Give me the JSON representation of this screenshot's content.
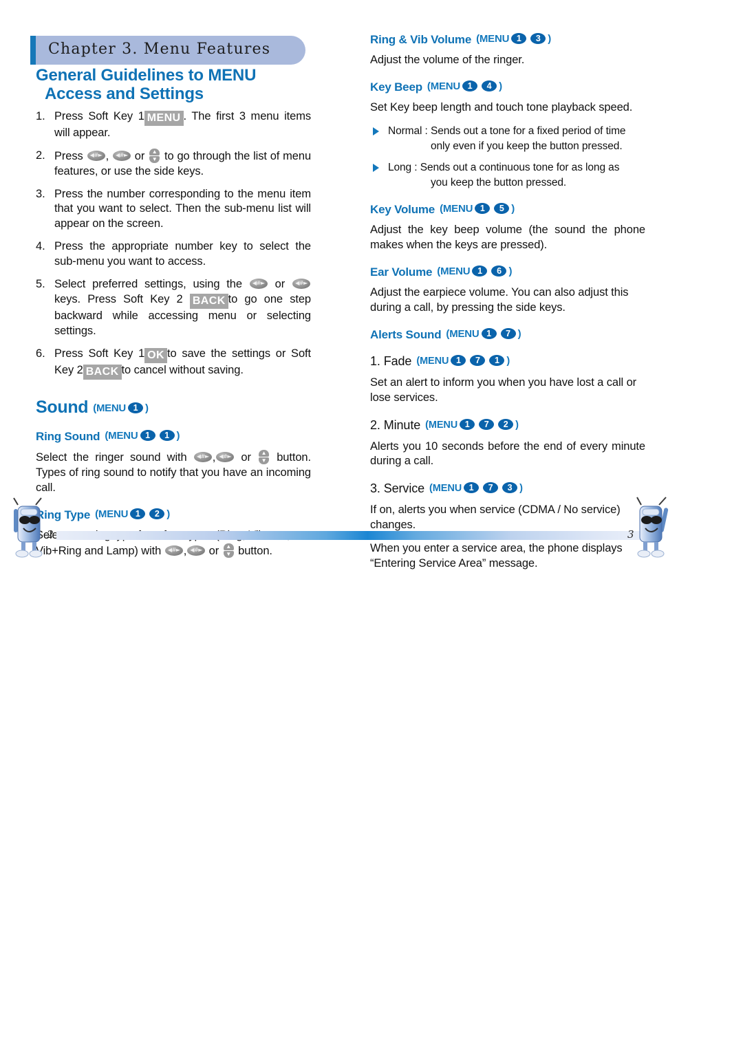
{
  "chapter": {
    "banner_text": "Chapter 3. Menu Features"
  },
  "left_column": {
    "heading_line1": "General Guidelines to MENU",
    "heading_line2": "Access and Settings",
    "steps": [
      {
        "num": "1.",
        "text_before": "Press Soft Key 1",
        "softkey": "MENU",
        "text_after": ". The first 3 menu items will appear."
      },
      {
        "num": "2.",
        "text_before": "Press",
        "text_mid": ", ",
        "text_or": "or",
        "text_after": "to go through the list of menu features, or use the side keys."
      },
      {
        "num": "3.",
        "text": "Press the number corresponding to the menu item that you want to select. Then the sub-menu list will appear on the screen."
      },
      {
        "num": "4.",
        "text": "Press the appropriate number key to select the sub-menu you want to access."
      },
      {
        "num": "5.",
        "text_a": "Select preferred settings, using the",
        "text_or": "or",
        "text_b": "keys. Press Soft Key 2",
        "softkey": "BACK",
        "text_c": "to go one step backward while accessing menu or selecting settings."
      },
      {
        "num": "6.",
        "text_a": "Press Soft Key 1",
        "softkey_ok": "OK",
        "text_b": "to save the settings or Soft Key 2",
        "softkey_back": "BACK",
        "text_c": "to cancel without saving."
      }
    ],
    "sound_section": {
      "title": "Sound",
      "menu_label": "MENU",
      "menu_codes": [
        "1"
      ]
    },
    "entries": [
      {
        "title": "Ring Sound",
        "menu_label": "MENU",
        "menu_codes": [
          "1",
          "1"
        ],
        "body_a": "Select the ringer sound with",
        "body_or": "or",
        "body_b": "button. Types of ring sound to notify that you have an incoming call."
      },
      {
        "title": "Ring Type",
        "menu_label": "MENU",
        "menu_codes": [
          "1",
          "2"
        ],
        "body_a": "Select one ring type from four types (Ring, Vibrator, Vib+Ring and Lamp) with",
        "body_or": "or",
        "body_b": "button."
      }
    ]
  },
  "right_column": {
    "entries": [
      {
        "title": "Ring & Vib Volume",
        "menu_label": "MENU",
        "menu_codes": [
          "1",
          "3"
        ],
        "body": "Adjust the volume of the ringer."
      },
      {
        "title": "Key Beep",
        "menu_label": "MENU",
        "menu_codes": [
          "1",
          "4"
        ],
        "body": "Set Key beep length and touch tone playback speed."
      },
      {
        "title": "Key Volume",
        "menu_label": "MENU",
        "menu_codes": [
          "1",
          "5"
        ],
        "body": "Adjust the key beep volume (the sound the phone makes when the keys are pressed)."
      },
      {
        "title": "Ear Volume",
        "menu_label": "MENU",
        "menu_codes": [
          "1",
          "6"
        ],
        "body": "Adjust the earpiece volume. You can also adjust this during a call, by pressing the side keys."
      },
      {
        "title": "Alerts Sound",
        "menu_label": "MENU",
        "menu_codes": [
          "1",
          "7"
        ]
      }
    ],
    "key_beep_bullets": [
      {
        "line1": "Normal : Sends out a tone for a fixed period of time",
        "line2": "only even if you keep the button pressed."
      },
      {
        "line1": "Long : Sends out a continuous tone for as long as",
        "line2": "you keep the button pressed."
      }
    ],
    "alerts_items": [
      {
        "title": "1. Fade",
        "menu_label": "MENU",
        "menu_codes": [
          "1",
          "7",
          "1"
        ],
        "body": "Set an alert to inform you when you have lost a call or lose services."
      },
      {
        "title": "2. Minute",
        "menu_label": "MENU",
        "menu_codes": [
          "1",
          "7",
          "2"
        ],
        "body": "Alerts you 10 seconds before the end of every minute during a call."
      },
      {
        "title": "3. Service",
        "menu_label": "MENU",
        "menu_codes": [
          "1",
          "7",
          "3"
        ],
        "body": "If on, alerts you when service (CDMA / No service) changes.",
        "body2": "When you enter a service area, the phone displays “Entering Service Area” message."
      }
    ]
  },
  "footer": {
    "page_left": "3 2",
    "page_right": "3 3"
  },
  "icons": {
    "key_clear": "clear-key-icon",
    "key_star": "star-key-icon",
    "side_key": "side-updown-key-icon",
    "bullet": "triangle-bullet-icon",
    "mascot": "phone-mascot-icon"
  },
  "colors": {
    "heading_blue": "#0f72b5",
    "accent_blue": "#1378bc",
    "dot_blue": "#0a63ab",
    "banner_bg": "#a9b9dc",
    "softkey_gray": "#a6a6a6"
  }
}
